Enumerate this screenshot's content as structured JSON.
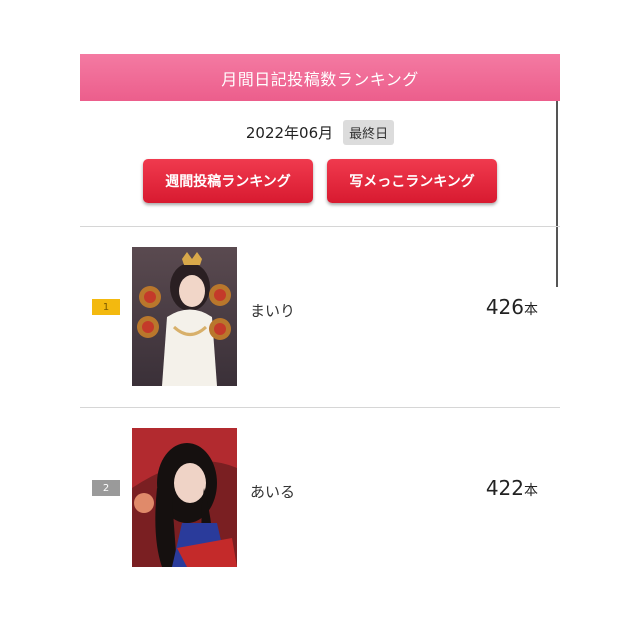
{
  "header": {
    "title": "月間日記投稿数ランキング"
  },
  "period": {
    "month": "2022年06月",
    "badge": "最終日"
  },
  "buttons": {
    "weekly": "週間投稿ランキング",
    "photo": "写メっこランキング"
  },
  "entries": [
    {
      "rank": "1",
      "name": "まいり",
      "count": "426",
      "unit": "本"
    },
    {
      "rank": "2",
      "name": "あいる",
      "count": "422",
      "unit": "本"
    }
  ]
}
